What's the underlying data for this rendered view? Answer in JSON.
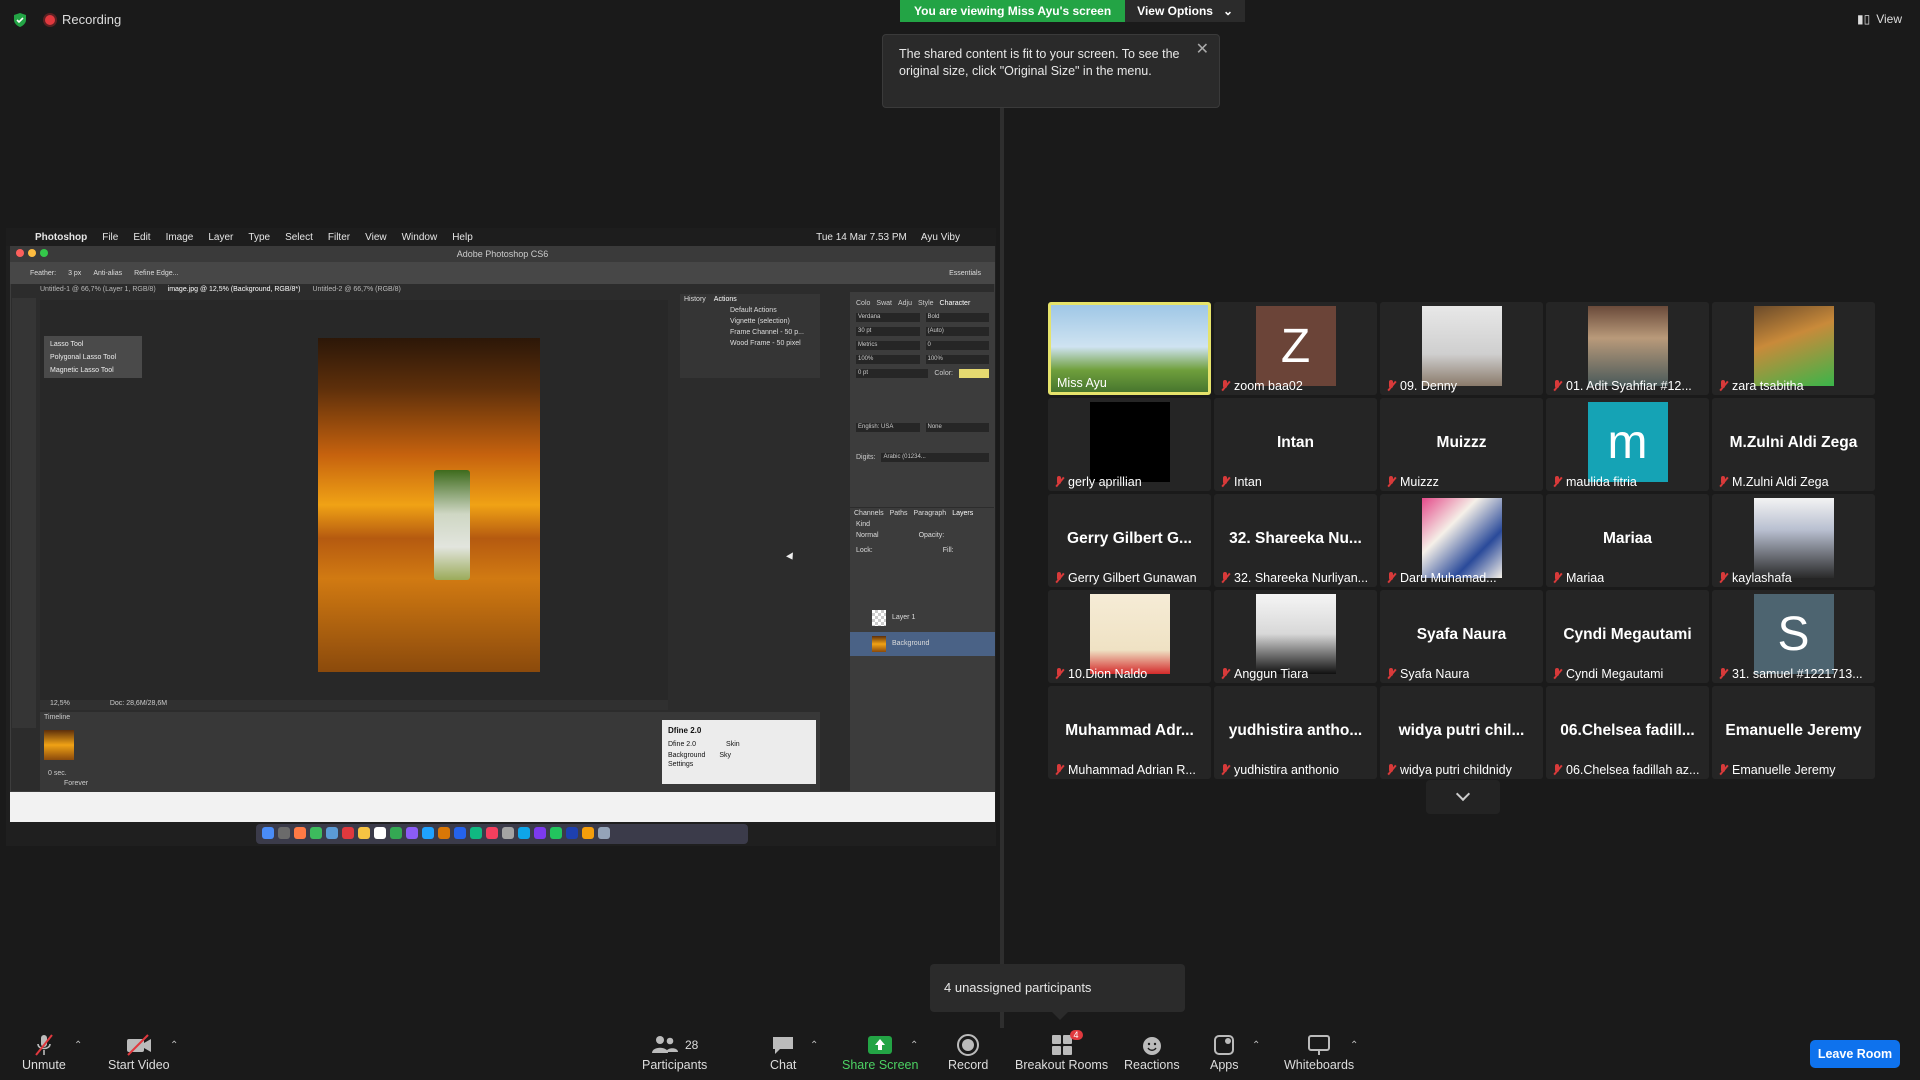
{
  "top": {
    "recording": "Recording",
    "banner": "You are viewing Miss Ayu's screen",
    "view_options": "View Options",
    "view": "View",
    "tooltip": "The shared content is fit to your screen. To see the original size, click \"Original Size\" in the menu."
  },
  "share": {
    "mac_menu": [
      "Photoshop",
      "File",
      "Edit",
      "Image",
      "Layer",
      "Type",
      "Select",
      "Filter",
      "View",
      "Window",
      "Help"
    ],
    "mac_clock": "Tue 14 Mar 7.53 PM",
    "mac_user": "Ayu Viby",
    "window_title": "Adobe Photoshop CS6",
    "tabs": [
      "Untitled-1 @ 66,7% (Layer 1, RGB/8)",
      "image.jpg @ 12,5% (Background, RGB/8*)",
      "Untitled-2 @ 66,7% (RGB/8)"
    ],
    "feather": "Feather:",
    "feather_val": "3 px",
    "anti_alias": "Anti-alias",
    "refine_edge": "Refine Edge...",
    "essentials": "Essentials",
    "lasso_tools": [
      "Lasso Tool",
      "Polygonal Lasso Tool",
      "Magnetic Lasso Tool"
    ],
    "history_tabs": [
      "History",
      "Actions"
    ],
    "actions": [
      "Default Actions",
      "Vignette (selection)",
      "Frame Channel - 50 p...",
      "Wood Frame - 50 pixel"
    ],
    "char_tabs": [
      "Colo",
      "Swat",
      "Adju",
      "Style",
      "Character"
    ],
    "font_name": "Verdana",
    "font_style": "Bold",
    "font_size": "30 pt",
    "leading": "(Auto)",
    "kerning": "Metrics",
    "tracking": "0",
    "scale_v": "100%",
    "scale_h": "100%",
    "baseline": "0 pt",
    "color_label": "Color:",
    "language": "English: USA",
    "aa": "None",
    "digits": "Digits:",
    "digits_val": "Arabic (01234...",
    "layer_tabs": [
      "Channels",
      "Paths",
      "Paragraph",
      "Layers"
    ],
    "kind": "Kind",
    "normal": "Normal",
    "opacity": "Opacity:",
    "lock": "Lock:",
    "fill": "Fill:",
    "layers": [
      "Layer 1",
      "Background"
    ],
    "zoom": "12,5%",
    "doc": "Doc: 28,6M/28,6M",
    "timeline": "Timeline",
    "frame_time": "0 sec.",
    "forever": "Forever",
    "dfine_title": "Dfine 2.0",
    "dfine_rows": [
      [
        "Dfine 2.0",
        "Skin"
      ],
      [
        "Background",
        "Sky"
      ]
    ],
    "dfine_settings": "Settings"
  },
  "participants": [
    {
      "name": "Miss Ayu",
      "type": "video",
      "muted": false,
      "highlight": true
    },
    {
      "name": "zoom baa02",
      "type": "letter",
      "letter": "Z",
      "bg": "#6b4438",
      "muted": true
    },
    {
      "name": "09. Denny",
      "type": "video",
      "muted": true
    },
    {
      "name": "01. Adit Syahfiar #12...",
      "type": "video",
      "muted": true
    },
    {
      "name": "zara tsabitha",
      "type": "video",
      "muted": true
    },
    {
      "name": "gerly aprillian",
      "type": "black",
      "muted": true
    },
    {
      "name": "Intan",
      "type": "text",
      "big": "Intan",
      "muted": true
    },
    {
      "name": "Muizzz",
      "type": "text",
      "big": "Muizzz",
      "muted": true
    },
    {
      "name": "maulida fitria",
      "type": "letter",
      "letter": "m",
      "bg": "#15a3b5",
      "muted": true
    },
    {
      "name": "M.Zulni Aldi Zega",
      "type": "text",
      "big": "M.Zulni Aldi Zega",
      "muted": true
    },
    {
      "name": "Gerry Gilbert Gunawan",
      "type": "text",
      "big": "Gerry Gilbert G...",
      "muted": true
    },
    {
      "name": "32. Shareeka Nurliyan...",
      "type": "text",
      "big": "32. Shareeka Nu...",
      "muted": true
    },
    {
      "name": "Daru Muhamad...",
      "type": "video",
      "muted": true
    },
    {
      "name": "Mariaa",
      "type": "text",
      "big": "Mariaa",
      "muted": true
    },
    {
      "name": "kaylashafa",
      "type": "video",
      "muted": true
    },
    {
      "name": "10.Dion Naldo",
      "type": "video",
      "muted": true
    },
    {
      "name": "Anggun Tiara",
      "type": "video",
      "muted": true
    },
    {
      "name": "Syafa Naura",
      "type": "text",
      "big": "Syafa Naura",
      "muted": true
    },
    {
      "name": "Cyndi Megautami",
      "type": "text",
      "big": "Cyndi Megautami",
      "muted": true
    },
    {
      "name": "31. samuel #1221713...",
      "type": "letter",
      "letter": "S",
      "bg": "#4d6470",
      "muted": true
    },
    {
      "name": "Muhammad Adrian R...",
      "type": "text",
      "big": "Muhammad Adr...",
      "muted": true
    },
    {
      "name": "yudhistira anthonio",
      "type": "text",
      "big": "yudhistira antho...",
      "muted": true
    },
    {
      "name": "widya putri childnidy",
      "type": "text",
      "big": "widya putri chil...",
      "muted": true
    },
    {
      "name": "06.Chelsea fadillah az...",
      "type": "text",
      "big": "06.Chelsea fadill...",
      "muted": true
    },
    {
      "name": "Emanuelle Jeremy",
      "type": "text",
      "big": "Emanuelle Jeremy",
      "muted": true
    }
  ],
  "unassigned": "4 unassigned participants",
  "toolbar": {
    "unmute": "Unmute",
    "start_video": "Start Video",
    "participants": "Participants",
    "participants_count": "28",
    "chat": "Chat",
    "share_screen": "Share Screen",
    "record": "Record",
    "breakout": "Breakout Rooms",
    "breakout_badge": "4",
    "reactions": "Reactions",
    "apps": "Apps",
    "whiteboards": "Whiteboards",
    "leave": "Leave Room"
  },
  "colors": {
    "accent": "#0e72ed",
    "green": "#23a445",
    "highlight": "#e6e36b",
    "muted": "#d83a3a"
  }
}
